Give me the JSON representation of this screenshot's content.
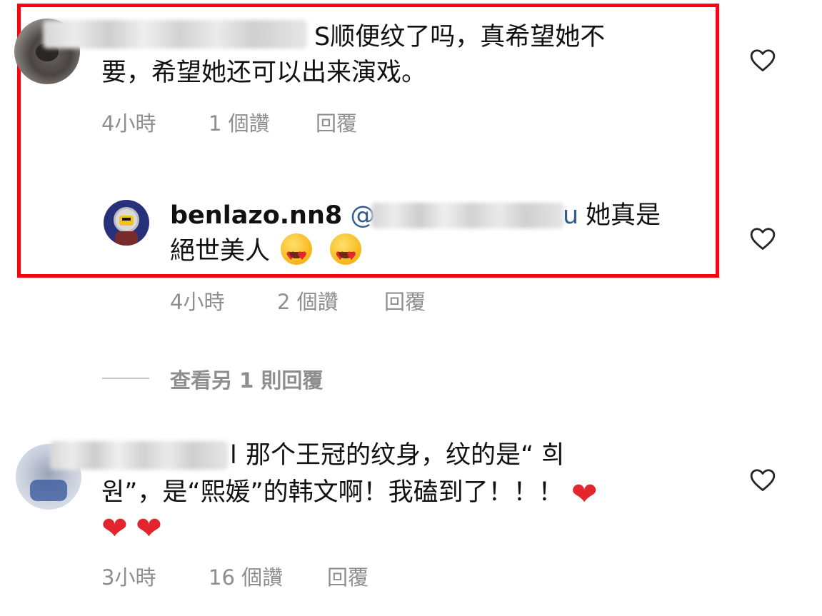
{
  "comments": [
    {
      "text_line1": "S顺便纹了吗，真希望她不",
      "text_line2": "要，希望她还可以出来演戏。",
      "time": "4小時",
      "likes": "1 個讚",
      "reply": "回覆"
    },
    {
      "username": "benlazo.nn8",
      "mention_suffix": "u",
      "mention_at": "@",
      "text_line1_rest": "她真是",
      "text_line2": "絕世美人",
      "time": "4小時",
      "likes": "2 個讚",
      "reply": "回覆"
    },
    {
      "text_line1_prefix": "l",
      "text_line1": "那个王冠的纹身，纹的是“ 희",
      "text_line2": "원”，是“熙媛”的韩文啊！我磕到了！！！",
      "time": "3小時",
      "likes": "16 個讚",
      "reply": "回覆"
    }
  ],
  "view_more_replies": "查看另 1 則回覆",
  "icons": {
    "like": "heart-outline-icon",
    "emoji_heart_eyes": "heart-eyes-emoji",
    "emoji_red_heart": "red-heart-emoji"
  },
  "colors": {
    "highlight": "#ff0010",
    "mention": "#345c8c",
    "meta": "#8e8e8e"
  }
}
